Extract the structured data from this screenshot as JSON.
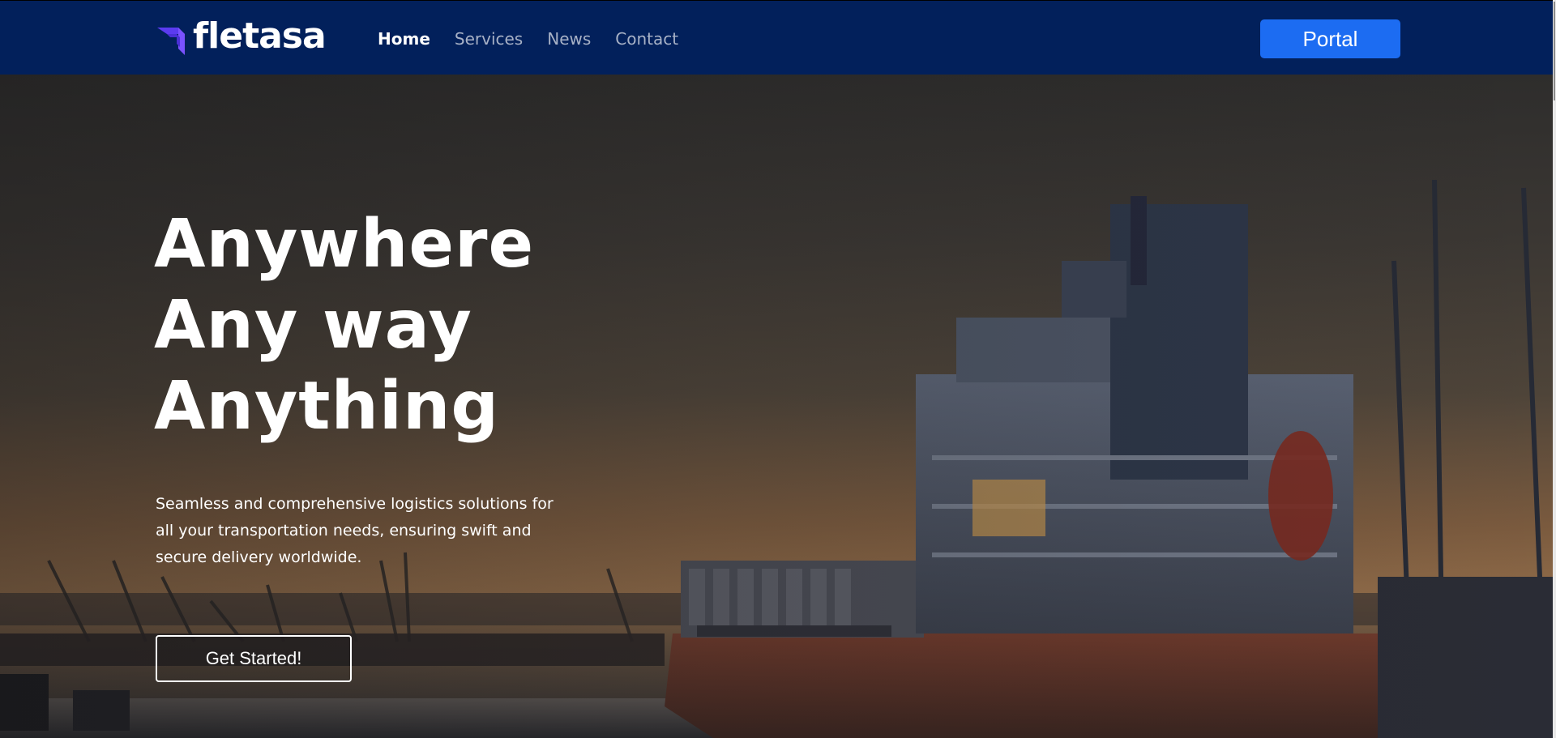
{
  "header": {
    "logo_text": "fletasa",
    "nav": [
      {
        "label": "Home",
        "active": true
      },
      {
        "label": "Services",
        "active": false
      },
      {
        "label": "News",
        "active": false
      },
      {
        "label": "Contact",
        "active": false
      }
    ],
    "portal_label": "Portal"
  },
  "hero": {
    "title_lines": [
      "Anywhere",
      "Any way",
      "Anything"
    ],
    "description": "Seamless and comprehensive logistics solutions for all your transportation needs, ensuring swift and secure delivery worldwide.",
    "cta_label": "Get Started!",
    "background": "cargo-ship-port-sunset-image"
  },
  "colors": {
    "header_bg": "#02205b",
    "portal_button": "#1c6cf2",
    "nav_active": "#ffffff",
    "nav_inactive": "#a7b1c6",
    "logo_accent": "#6a3df5"
  },
  "icons": {
    "logo_mark": "fletasa-logo-icon"
  }
}
